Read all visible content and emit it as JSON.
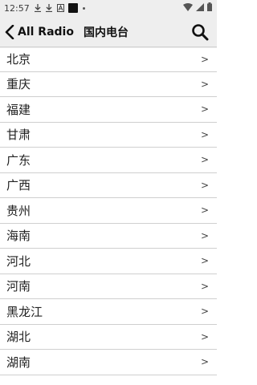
{
  "status_bar": {
    "time": "12:57",
    "icons": [
      "download-icon",
      "download-icon",
      "app-a-icon",
      "black-square-icon",
      "dot-icon",
      "wifi-icon",
      "signal-icon",
      "battery-icon"
    ]
  },
  "app_bar": {
    "back_label": "All Radio",
    "title": "国内电台",
    "search_icon": "search-icon"
  },
  "list": {
    "chevron": ">",
    "items": [
      {
        "label": "北京"
      },
      {
        "label": "重庆"
      },
      {
        "label": "福建"
      },
      {
        "label": "甘肃"
      },
      {
        "label": "广东"
      },
      {
        "label": "广西"
      },
      {
        "label": "贵州"
      },
      {
        "label": "海南"
      },
      {
        "label": "河北"
      },
      {
        "label": "河南"
      },
      {
        "label": "黑龙江"
      },
      {
        "label": "湖北"
      },
      {
        "label": "湖南"
      }
    ]
  }
}
